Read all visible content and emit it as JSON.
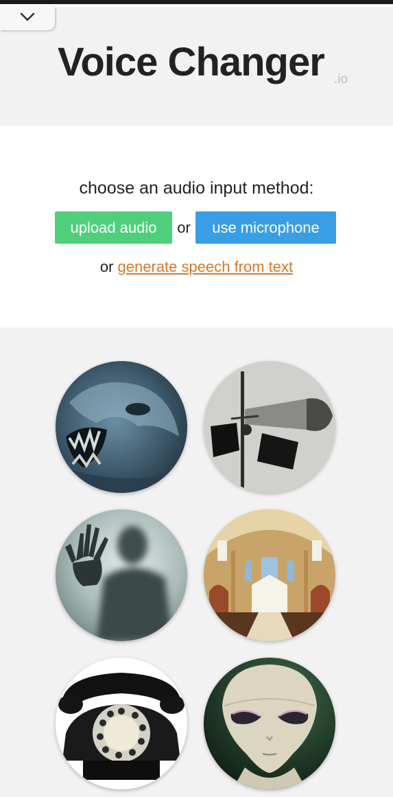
{
  "header": {
    "collapse_icon": "chevron-down-icon",
    "title": "Voice Changer",
    "title_suffix": ".io"
  },
  "input_panel": {
    "prompt": "choose an audio input method:",
    "upload_label": "upload audio",
    "or_between": "or",
    "microphone_label": "use microphone",
    "or_prefix": "or",
    "generate_link": "generate speech from text"
  },
  "voices": [
    {
      "id": "monster",
      "icon": "monster-face-image"
    },
    {
      "id": "megaphone",
      "icon": "megaphone-speakers-image"
    },
    {
      "id": "ghost",
      "icon": "ghost-silhouette-image"
    },
    {
      "id": "cathedral",
      "icon": "cathedral-interior-image"
    },
    {
      "id": "telephone",
      "icon": "rotary-telephone-image"
    },
    {
      "id": "alien",
      "icon": "alien-face-image"
    }
  ],
  "colors": {
    "upload_button": "#4fcf7c",
    "microphone_button": "#3a9ee6",
    "link": "#d3792a",
    "title": "#222222"
  }
}
